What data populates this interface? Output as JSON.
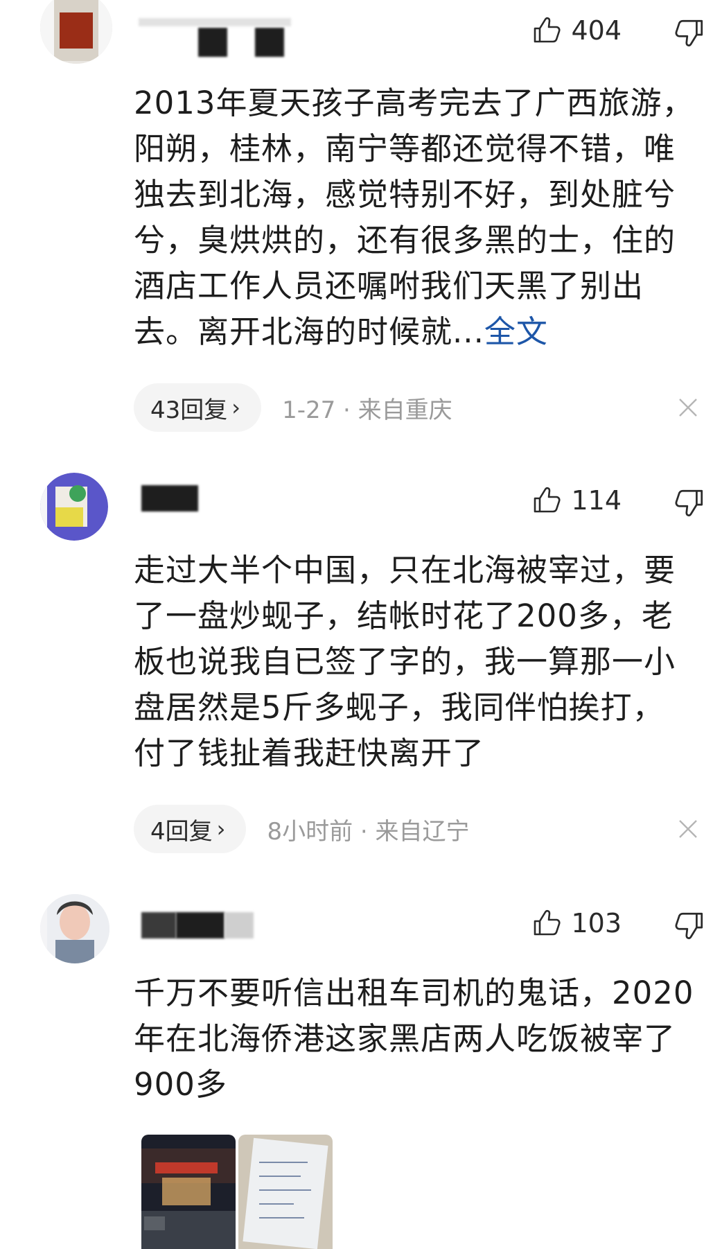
{
  "comments": [
    {
      "likes": "404",
      "text": "2013年夏天孩子高考完去了广西旅游，\n阳朔，桂林，南宁等都还觉得不错，唯\n独去到北海，感觉特别不好，到处脏兮\n兮，臭烘烘的，还有很多黑的士，住的\n酒店工作人员还嘱咐我们天黑了别出\n去。离开北海的时候就...",
      "more_label": "全文",
      "replies_label": "43回复",
      "time": "1-27 · 来自重庆"
    },
    {
      "likes": "114",
      "text": "走过大半个中国，只在北海被宰过，要\n了一盘炒蚬子，结帐时花了200多，老\n板也说我自已签了字的，我一算那一小\n盘居然是5斤多蚬子，我同伴怕挨打，\n付了钱扯着我赶快离开了",
      "replies_label": "4回复",
      "time": "8小时前 · 来自辽宁"
    },
    {
      "likes": "103",
      "text": "千万不要听信出租车司机的鬼话，2020\n年在北海侨港这家黑店两人吃饭被宰了\n900多"
    }
  ],
  "icons": {
    "like": "thumbs-up-icon",
    "dislike": "thumbs-down-icon",
    "chevron": "chevron-right-icon",
    "close": "close-icon"
  },
  "colors": {
    "link": "#1d56a8",
    "meta": "#9a9a9a",
    "pill": "#f4f4f4"
  }
}
